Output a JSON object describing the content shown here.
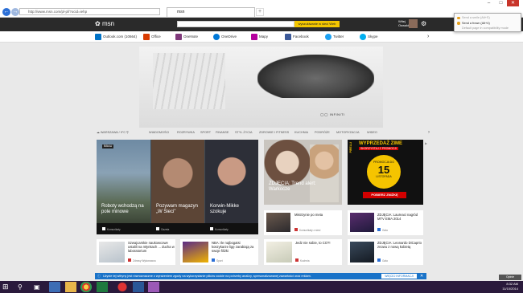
{
  "browser": {
    "url": "http://www.msn.com/pl-pl/?ocid=iehp",
    "tab_title": "msn",
    "new_tab": "+",
    "back": "←",
    "forward": "→",
    "window_controls": {
      "minimize": "–",
      "maximize": "□",
      "close": "✕"
    }
  },
  "popup": {
    "items": [
      "Send a smile (Alt+S)",
      "Send a frown (Alt+4)",
      "Default page in compatibility mode"
    ]
  },
  "header": {
    "logo": "msn",
    "search_button": "wyszukiwanie w sieci Web",
    "user": "Witej Oswald",
    "settings_icon": "⚙"
  },
  "shortcuts": [
    {
      "label": "Outlook.com (10664)",
      "color": "#0072c6"
    },
    {
      "label": "Office",
      "color": "#d83b01"
    },
    {
      "label": "OneNote",
      "color": "#80397b"
    },
    {
      "label": "OneDrive",
      "color": "#0078d7"
    },
    {
      "label": "Mapy",
      "color": "#b4009e"
    },
    {
      "label": "Facebook",
      "color": "#3b5998"
    },
    {
      "label": "Twitter",
      "color": "#1da1f2"
    },
    {
      "label": "Skype",
      "color": "#00aff0"
    }
  ],
  "shortcuts_next": "›",
  "ad": {
    "brand": "INFINITI"
  },
  "categories": {
    "location": "WARSZAWA / 9°C",
    "items": [
      "WIADOMOŚCI",
      "ROZRYWKA",
      "SPORT",
      "FINANSE",
      "STYL ŻYCIA",
      "ZDROWIE I FITNESS",
      "KUCHNIA",
      "PODRÓŻE",
      "MOTORYZACJA",
      "WIDEO"
    ],
    "next": "›"
  },
  "hero": {
    "badge": "BBAU",
    "stories": [
      {
        "title": "Roboty wchodzą na pole minowe",
        "source": "Komunikaty"
      },
      {
        "title": "Pozywam magazyn „W Sieci”",
        "source": "Gazeta"
      },
      {
        "title": "Korwin-Mikke szokuje",
        "source": "Komunikaty"
      }
    ]
  },
  "feature": {
    "title": "ZDJĘCIA: Trend alert: Warkocze"
  },
  "promo": {
    "title": "WYPRZEDAŻ ZIME",
    "subtitle": "SKORZYSTAJ Z PROMOCJI",
    "brand": "PIRELLI",
    "circle_top": "PROMOCJA DO",
    "day": "15",
    "month": "LISTOPADA",
    "cta": "POBIERZ ZNIŻKĘ"
  },
  "cards_mid": [
    {
      "title": "Mistrzynie po meta",
      "source": "Komunikaty z sieci"
    },
    {
      "title": "ZDJĘCIA: Laureaci nagród MTV EMA 2014",
      "source": "Gala"
    }
  ],
  "cards_bottom": [
    {
      "title": "Szwajcarskie naukowcowe ustalili na młynkach ... ducha w laboratorium",
      "source": "Zdrowy Wykonawca"
    },
    {
      "title": "NBA: Ile najbogatsi koszykarze ligę zarabiają za swoje filiżki",
      "source": "Sport"
    },
    {
      "title": "Jedz nie sobie, to CO?!",
      "source": "Kuchnia"
    },
    {
      "title": "ZDJĘCIA: Leonardo DiCaprio znowu z nową kobietą",
      "source": "Gala"
    }
  ],
  "notification": {
    "text": "Użycie tej witryny jest równoznaczne z wyrażeniem zgody na wykorzystanie plików cookie na potrzeby analizy, spersonalizowanej zawartości oraz reklam.",
    "button": "WIĘCEJ INFORMACJI",
    "close": "✕"
  },
  "opinion_button": "Opinie",
  "taskbar": {
    "time": "8:32 AM",
    "date": "11/10/2014"
  }
}
